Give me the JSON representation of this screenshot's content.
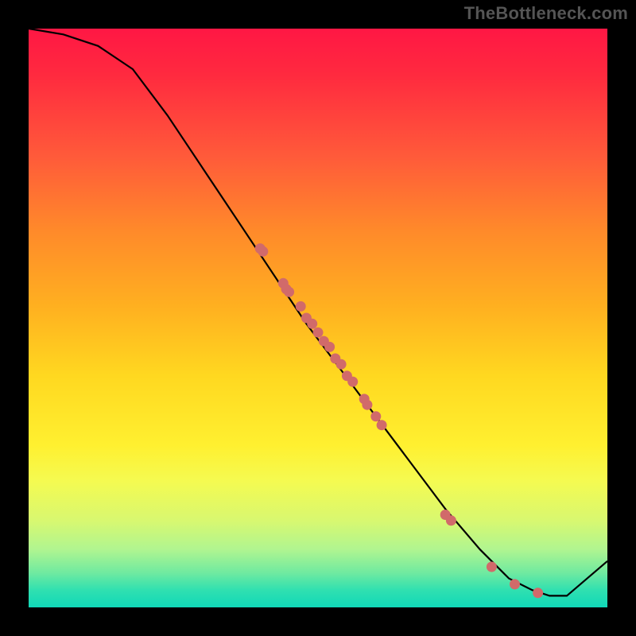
{
  "watermark": "TheBottleneck.com",
  "colors": {
    "background_top": "#ff1744",
    "background_mid": "#ffd820",
    "background_bottom": "#10d8b8",
    "curve_stroke": "#000000",
    "dot_fill": "#d16a6a"
  },
  "chart_data": {
    "type": "line",
    "title": "",
    "xlabel": "",
    "ylabel": "",
    "xlim": [
      0,
      100
    ],
    "ylim": [
      0,
      100
    ],
    "grid": false,
    "series": [
      {
        "name": "curve",
        "x": [
          0,
          6,
          12,
          18,
          24,
          30,
          36,
          42,
          48,
          54,
          60,
          66,
          72,
          78,
          83,
          87,
          90,
          93,
          100
        ],
        "y": [
          100,
          99,
          97,
          93,
          85,
          76,
          67,
          58,
          49,
          41,
          33,
          25,
          17,
          10,
          5,
          3,
          2,
          2,
          8
        ]
      }
    ],
    "scatter": [
      {
        "name": "dots",
        "x": [
          40,
          40.5,
          44,
          44.5,
          45,
          47,
          48,
          49,
          50,
          51,
          52,
          53,
          54,
          55,
          56,
          58,
          58.5,
          60,
          61,
          72,
          73,
          80,
          84,
          88
        ],
        "y": [
          62,
          61.5,
          56,
          55,
          54.5,
          52,
          50,
          49,
          47.5,
          46,
          45,
          43,
          42,
          40,
          39,
          36,
          35,
          33,
          31.5,
          16,
          15,
          7,
          4,
          2.5
        ]
      }
    ]
  }
}
